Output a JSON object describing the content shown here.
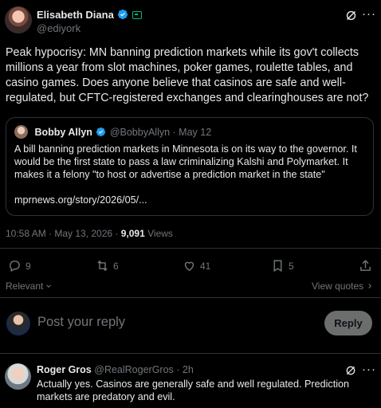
{
  "tweet": {
    "display_name": "Elisabeth Diana",
    "handle": "@ediyork",
    "text": "Peak hypocrisy: MN banning prediction markets while its gov't collects millions a year from slot machines, poker games, roulette tables, and casino games. Does anyone believe that casinos are safe and well-regulated, but CFTC-registered exchanges and clearinghouses are not?",
    "quoted": {
      "display_name": "Bobby Allyn",
      "handle_date": "@BobbyAllyn · May 12",
      "text": "A bill banning prediction markets in Minnesota is on its way to the governor. It would be the first state to pass a law criminalizing Kalshi and Polymarket. It makes it a felony \"to host or advertise a prediction market in the state\"",
      "link": "mprnews.org/story/2026/05/..."
    },
    "timestamp": "10:58 AM · May 13, 2026 · ",
    "views_count": "9,091",
    "views_label": " Views",
    "stats": {
      "replies": "9",
      "reposts": "6",
      "likes": "41",
      "bookmarks": "5"
    }
  },
  "sort": {
    "label": "Relevant",
    "view_quotes": "View quotes"
  },
  "composer": {
    "placeholder": "Post your reply",
    "button": "Reply"
  },
  "reply": {
    "display_name": "Roger Gros",
    "handle_time": "@RealRogerGros · 2h",
    "text": "Actually yes. Casinos are generally safe and well regulated. Prediction markets are predatory and evil."
  },
  "colors": {
    "verified": "#1d9bf0",
    "accent_green": "#00ba7c",
    "muted": "#71767b",
    "border": "#2f3336"
  }
}
